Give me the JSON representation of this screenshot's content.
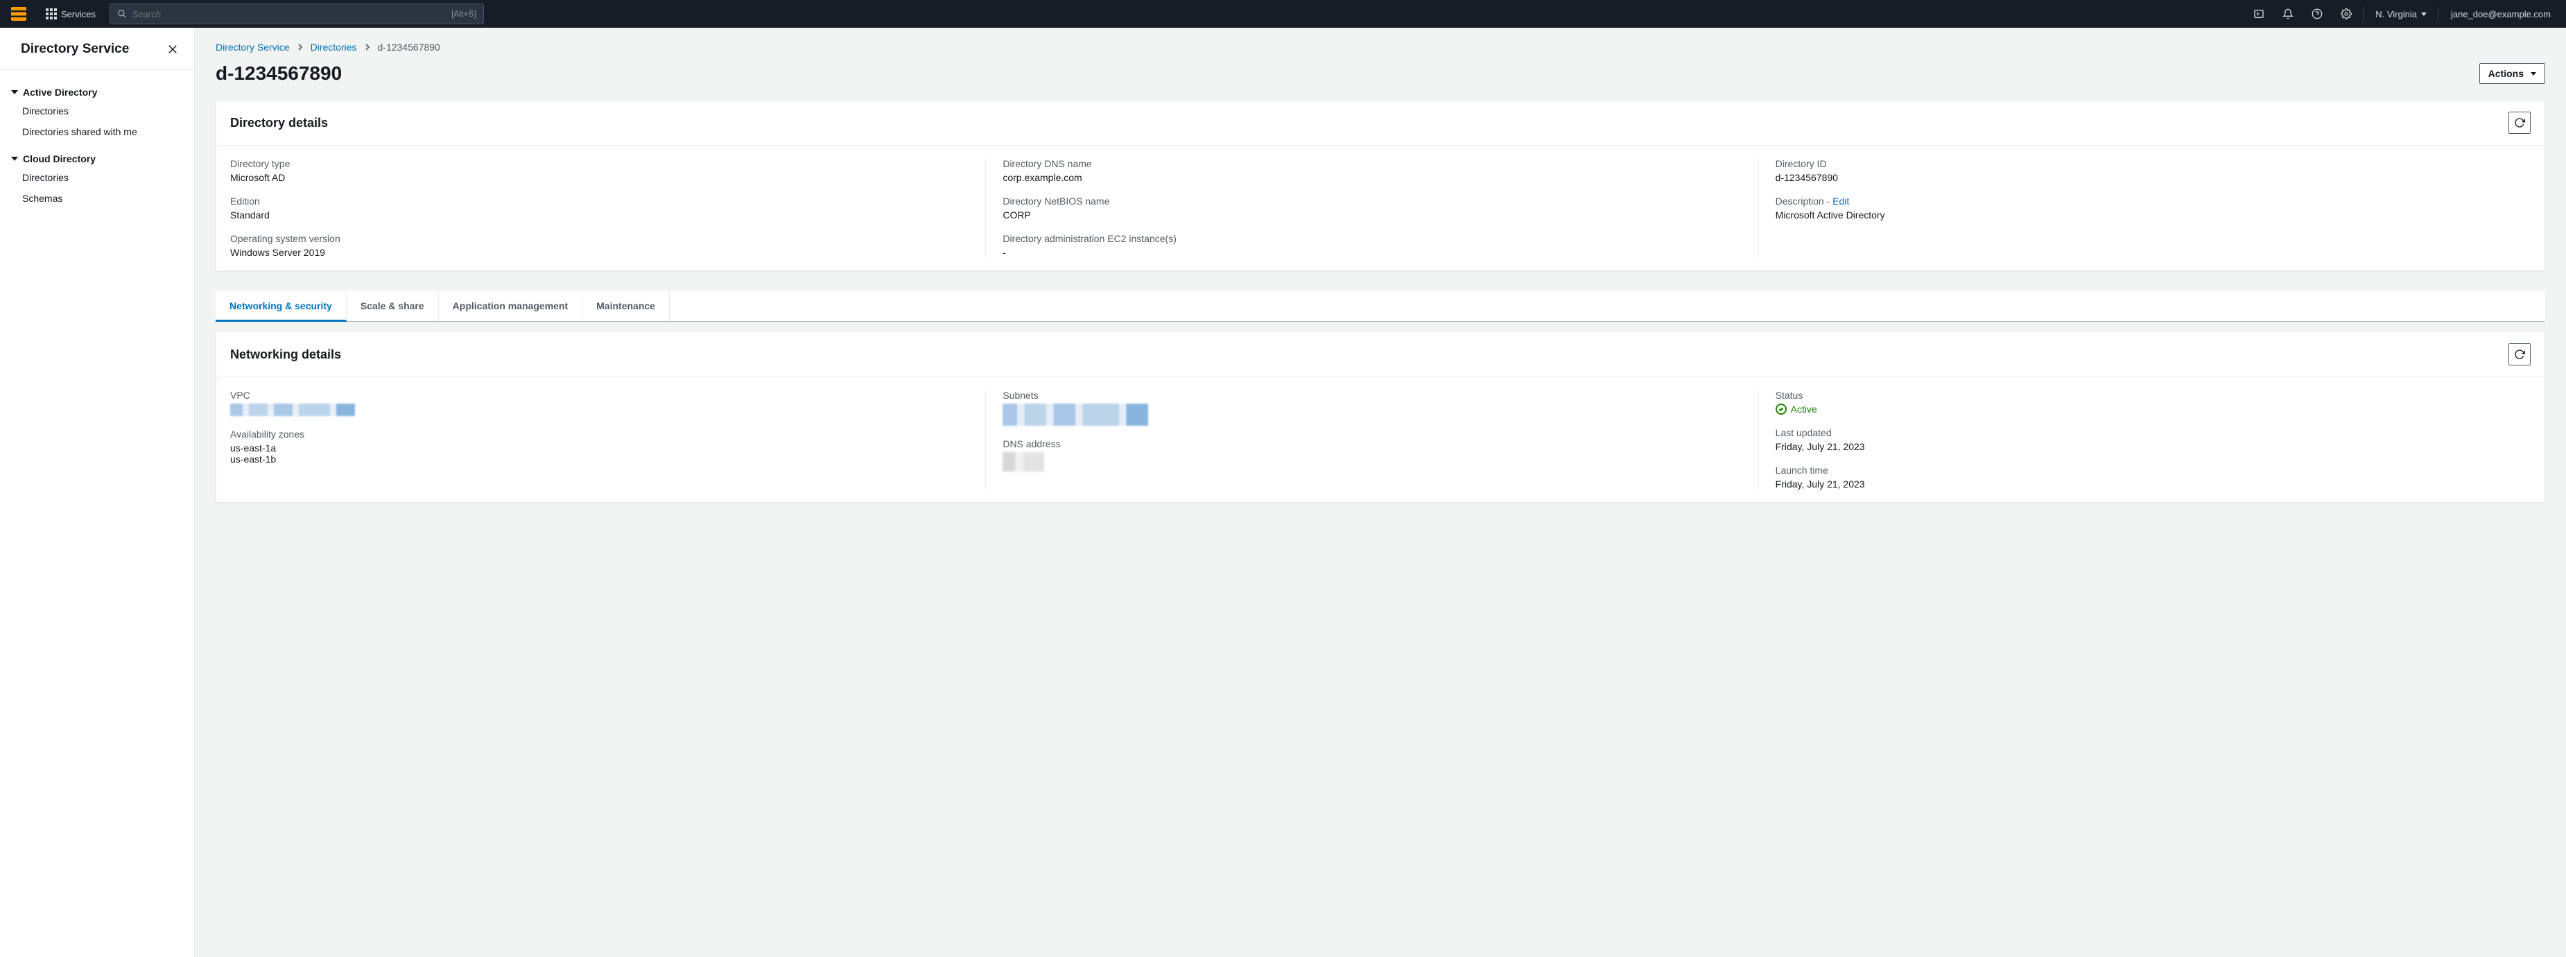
{
  "topbar": {
    "services_label": "Services",
    "search_placeholder": "Search",
    "search_shortcut": "[Alt+S]",
    "region": "N. Virginia",
    "account": "jane_doe@example.com"
  },
  "sidebar": {
    "title": "Directory Service",
    "groups": [
      {
        "label": "Active Directory",
        "items": [
          "Directories",
          "Directories shared with me"
        ]
      },
      {
        "label": "Cloud Directory",
        "items": [
          "Directories",
          "Schemas"
        ]
      }
    ]
  },
  "breadcrumb": {
    "items": [
      {
        "label": "Directory Service",
        "link": true
      },
      {
        "label": "Directories",
        "link": true
      },
      {
        "label": "d-1234567890",
        "link": false
      }
    ]
  },
  "page": {
    "title": "d-1234567890",
    "actions_label": "Actions"
  },
  "directory_details_panel": {
    "title": "Directory details",
    "col1": {
      "directory_type": {
        "label": "Directory type",
        "value": "Microsoft AD"
      },
      "edition": {
        "label": "Edition",
        "value": "Standard"
      },
      "os_version": {
        "label": "Operating system version",
        "value": "Windows Server 2019"
      }
    },
    "col2": {
      "dns_name": {
        "label": "Directory DNS name",
        "value": "corp.example.com"
      },
      "netbios": {
        "label": "Directory NetBIOS name",
        "value": "CORP"
      },
      "admin_ec2": {
        "label": "Directory administration EC2 instance(s)",
        "value": "-"
      }
    },
    "col3": {
      "directory_id": {
        "label": "Directory ID",
        "value": "d-1234567890"
      },
      "description": {
        "label": "Description - ",
        "edit": "Edit",
        "value": "Microsoft Active Directory"
      }
    }
  },
  "tabs": {
    "items": [
      "Networking & security",
      "Scale & share",
      "Application management",
      "Maintenance"
    ],
    "active": 0
  },
  "networking_details_panel": {
    "title": "Networking details",
    "col1": {
      "vpc": {
        "label": "VPC"
      },
      "azs": {
        "label": "Availability zones",
        "values": [
          "us-east-1a",
          "us-east-1b"
        ]
      }
    },
    "col2": {
      "subnets": {
        "label": "Subnets"
      },
      "dns_addr": {
        "label": "DNS address"
      }
    },
    "col3": {
      "status": {
        "label": "Status",
        "value": "Active"
      },
      "last_updated": {
        "label": "Last updated",
        "value": "Friday, July 21, 2023"
      },
      "launch_time": {
        "label": "Launch time",
        "value": "Friday, July 21, 2023"
      }
    }
  }
}
